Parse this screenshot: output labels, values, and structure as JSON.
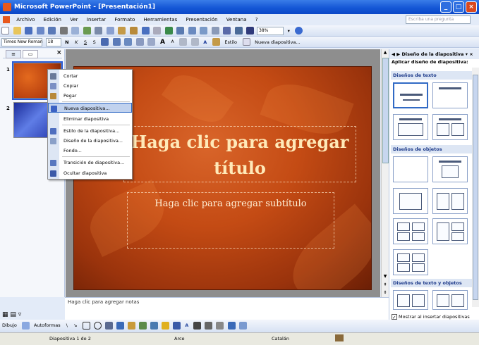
{
  "window": {
    "title": "Microsoft PowerPoint - [Presentación1]"
  },
  "menu": {
    "items": [
      "Archivo",
      "Edición",
      "Ver",
      "Insertar",
      "Formato",
      "Herramientas",
      "Presentación",
      "Ventana",
      "?"
    ],
    "help_placeholder": "Escriba una pregunta"
  },
  "toolbar": {
    "zoom": "38%"
  },
  "format_toolbar": {
    "font": "Times New Roman",
    "size": "18",
    "bold": "N",
    "italic": "K",
    "underline": "S",
    "shadow": "S",
    "design_label": "Estilo",
    "new_slide_label": "Nueva diapositiva..."
  },
  "slides_pane": {
    "tab_outline": "≡",
    "tab_slides": "▭",
    "close": "×",
    "slide_numbers": [
      "1",
      "2"
    ]
  },
  "context_menu": {
    "items": [
      {
        "label": "Cortar",
        "icon": "scissors-icon",
        "color": "#6b7a99"
      },
      {
        "label": "Copiar",
        "icon": "copy-icon",
        "color": "#7a8fc4"
      },
      {
        "label": "Pegar",
        "icon": "paste-icon",
        "color": "#b8893a"
      },
      {
        "label": "Nueva diapositiva...",
        "icon": "new-slide-icon",
        "color": "#3b62c4"
      },
      {
        "label": "Eliminar diapositiva",
        "icon": "",
        "color": ""
      },
      {
        "label": "Estilo de la diapositiva...",
        "icon": "slide-design-icon",
        "color": "#4f6fbf"
      },
      {
        "label": "Diseño de la diapositiva...",
        "icon": "slide-layout-icon",
        "color": "#8aa0c8"
      },
      {
        "label": "Fondo...",
        "icon": "",
        "color": ""
      },
      {
        "label": "Transición de diapositiva...",
        "icon": "transition-icon",
        "color": "#5878c0"
      },
      {
        "label": "Ocultar diapositiva",
        "icon": "hide-slide-icon",
        "color": "#3c5aa8"
      }
    ]
  },
  "slide": {
    "title": "Haga clic para agregar título",
    "subtitle": "Haga clic para agregar subtítulo"
  },
  "notes": {
    "placeholder": "Haga clic para agregar notas"
  },
  "task_pane": {
    "title": "Diseño de la diapositiva",
    "apply_label": "Aplicar diseño de diapositiva:",
    "sections": [
      "Diseños de texto",
      "Diseños de objetos",
      "Diseños de texto y objetos"
    ],
    "show_on_insert": "Mostrar al insertar diapositivas"
  },
  "drawing_toolbar": {
    "draw": "Dibujo",
    "autoshapes": "Autoformas"
  },
  "status": {
    "slide": "Diapositiva 1 de 2",
    "design": "Arce",
    "language": "Catalán"
  }
}
